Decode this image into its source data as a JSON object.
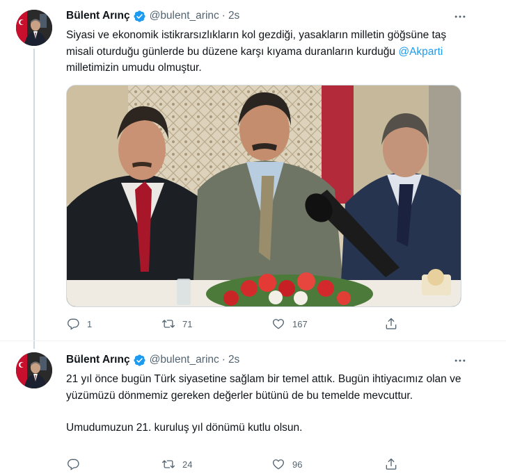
{
  "tweets": [
    {
      "author_name": "Bülent Arınç",
      "handle": "@bulent_arinc",
      "separator": "·",
      "time": "2s",
      "text_part1": "Siyasi ve ekonomik istikrarsızlıkların kol gezdiği, yasakların milletin göğsüne taş misali oturduğu günlerde bu düzene karşı kıyama duranların kurduğu ",
      "mention": "@Akparti",
      "text_part2": " milletimizin umudu olmuştur.",
      "replies": "1",
      "retweets": "71",
      "likes": "167",
      "icons": {
        "verified": "verified-badge-icon",
        "more": "more-icon",
        "reply": "reply-icon",
        "retweet": "retweet-icon",
        "like": "like-icon",
        "share": "share-icon"
      }
    },
    {
      "author_name": "Bülent Arınç",
      "handle": "@bulent_arinc",
      "separator": "·",
      "time": "2s",
      "text_para1": "21 yıl önce bugün Türk siyasetine sağlam bir temel attık. Bugün ihtiyacımız olan ve yüzümüzü dönmemiz gereken değerler bütünü de bu temelde mevcuttur.",
      "text_para2": "Umudumuzun 21. kuruluş yıl dönümü kutlu olsun.",
      "replies": "",
      "retweets": "24",
      "likes": "96",
      "icons": {
        "verified": "verified-badge-icon",
        "more": "more-icon",
        "reply": "reply-icon",
        "retweet": "retweet-icon",
        "like": "like-icon",
        "share": "share-icon"
      }
    }
  ],
  "colors": {
    "accent": "#1d9bf0",
    "secondary_text": "#536471",
    "primary_text": "#0f1419"
  }
}
